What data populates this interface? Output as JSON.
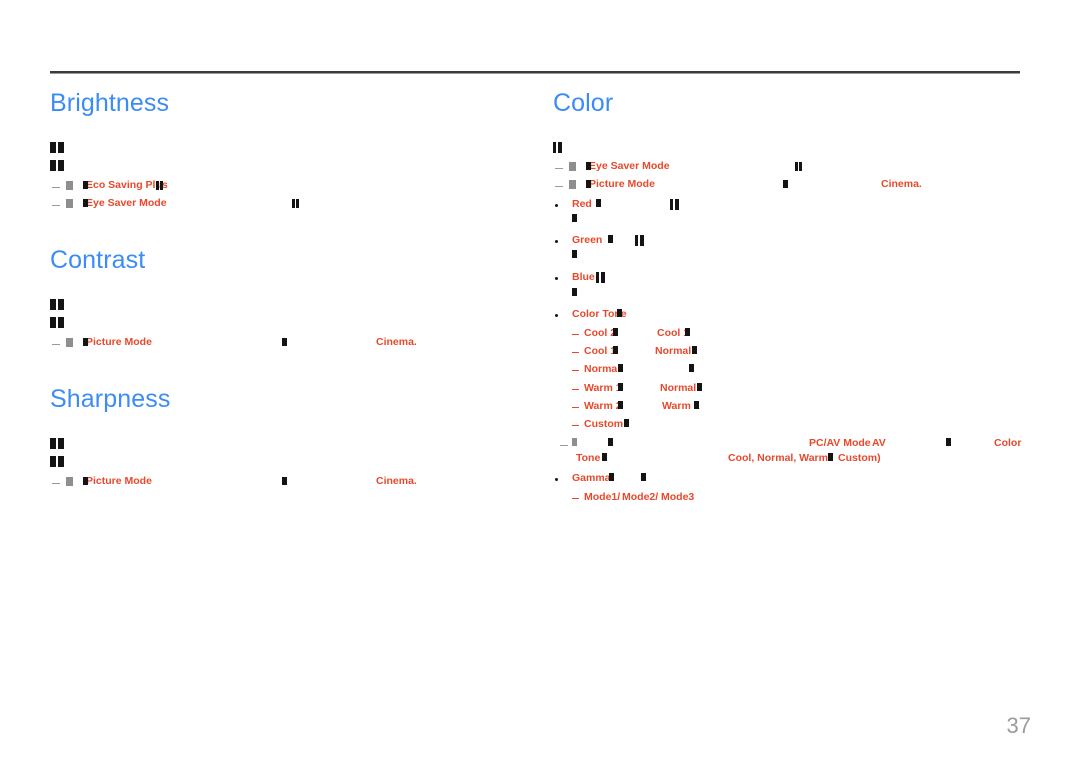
{
  "page": {
    "number": "37",
    "rule_color": "#3b3b3b",
    "heading_color": "#3c8cf5",
    "term_color": "#e8492b",
    "page_number_color": "#9b9b9b",
    "background": "#ffffff"
  },
  "left_column": {
    "sections": [
      {
        "title": "Brightness",
        "items": [
          {
            "kind": "glyph-line"
          },
          {
            "kind": "glyph-line"
          },
          {
            "kind": "note",
            "term": "Eco Saving Plus",
            "prefix_icon": "dash-marker"
          },
          {
            "kind": "note",
            "term": "Eye Saver Mode",
            "prefix_icon": "dash-marker"
          }
        ]
      },
      {
        "title": "Contrast",
        "items": [
          {
            "kind": "glyph-line"
          },
          {
            "kind": "glyph-line"
          },
          {
            "kind": "note",
            "term": "Picture Mode",
            "term2": "Cinema.",
            "prefix_icon": "dash-marker"
          }
        ]
      },
      {
        "title": "Sharpness",
        "items": [
          {
            "kind": "glyph-line"
          },
          {
            "kind": "glyph-line"
          },
          {
            "kind": "note",
            "term": "Picture Mode",
            "term2": "Cinema.",
            "prefix_icon": "dash-marker"
          }
        ]
      }
    ]
  },
  "right_column": {
    "sections": [
      {
        "title": "Color",
        "notes": [
          {
            "term": "Eye Saver Mode",
            "prefix_icon": "dash-marker"
          },
          {
            "term": "Picture Mode",
            "term2": "Cinema.",
            "prefix_icon": "dash-marker"
          }
        ],
        "bullets": [
          {
            "label": "Red"
          },
          {
            "label": "Green"
          },
          {
            "label": "Blue"
          },
          {
            "label": "Color Tone",
            "subitems": [
              {
                "label": "Cool 2",
                "label2": "Cool 1"
              },
              {
                "label": "Cool 1",
                "label2": "Normal"
              },
              {
                "label": "Normal"
              },
              {
                "label": "Warm 1",
                "label2": "Normal"
              },
              {
                "label": "Warm 2",
                "label2": "Warm 1"
              },
              {
                "label": "Custom"
              }
            ],
            "note": {
              "term_a": "PC/AV Mode",
              "term_b": "AV",
              "term_c": "Color",
              "term_d": "Tone",
              "term_e": "Cool, Normal, Warm",
              "term_f": "Custom)"
            }
          },
          {
            "label": "Gamma",
            "subitems": [
              {
                "label": "Mode1/",
                "label2": "Mode2/",
                "label3": "Mode3"
              }
            ]
          }
        ]
      }
    ]
  }
}
